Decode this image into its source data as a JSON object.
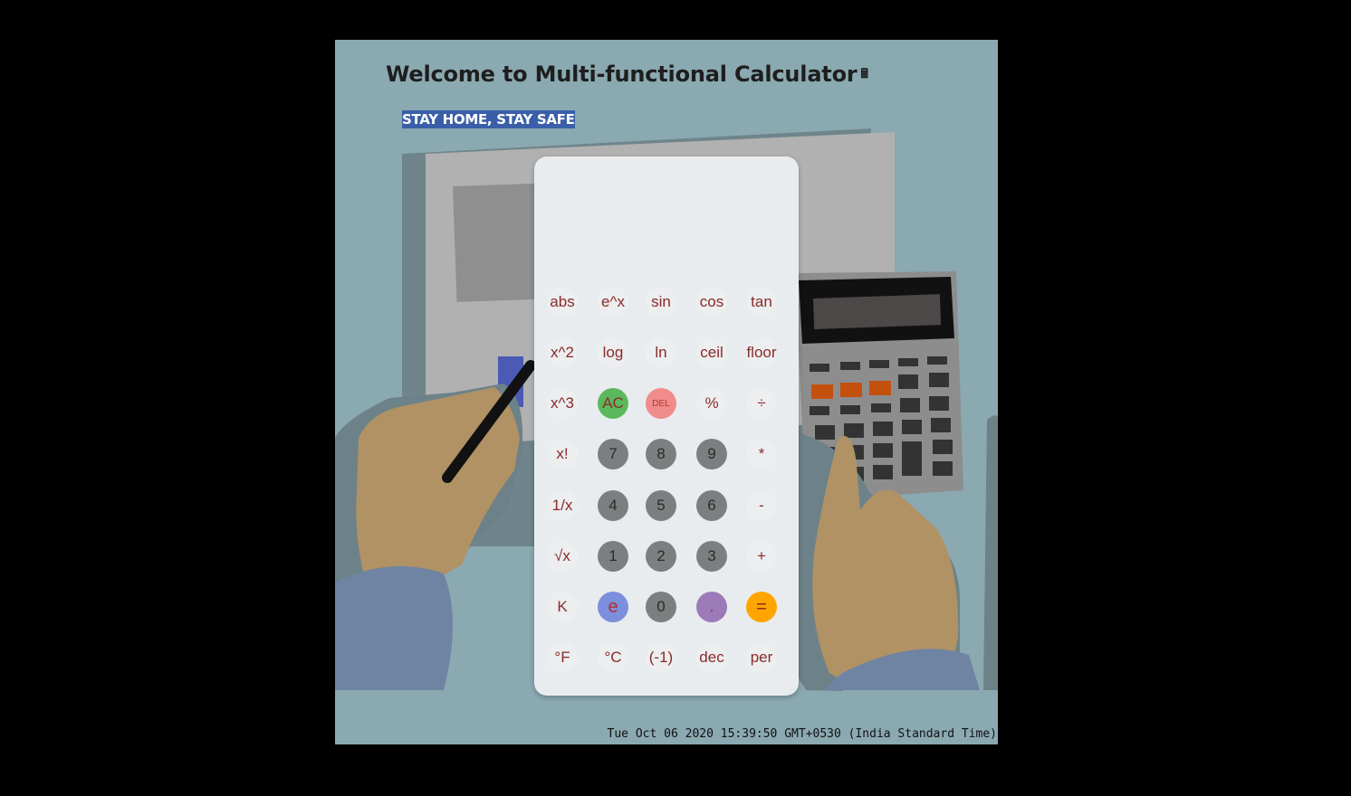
{
  "page": {
    "title": "Welcome to Multi-functional Calculator",
    "title_icon": "calculator-icon",
    "motto": "STAY HOME, STAY SAFE",
    "datetime": "Tue Oct 06 2020 15:39:50 GMT+0530 (India Standard Time)"
  },
  "calculator": {
    "display": "",
    "rows": [
      [
        "abs",
        "e^x",
        "sin",
        "cos",
        "tan"
      ],
      [
        "x^2",
        "log",
        "ln",
        "ceil",
        "floor"
      ],
      [
        "x^3",
        "AC",
        "DEL",
        "%",
        "÷"
      ],
      [
        "x!",
        "7",
        "8",
        "9",
        "*"
      ],
      [
        "1/x",
        "4",
        "5",
        "6",
        "-"
      ],
      [
        "√x",
        "1",
        "2",
        "3",
        "+"
      ],
      [
        "K",
        "e",
        "0",
        ".",
        "="
      ],
      [
        "°F",
        "°C",
        "(-1)",
        "dec",
        "per"
      ]
    ]
  },
  "colors": {
    "background": "#8aa9b1",
    "motto_bg": "#3a5fa8",
    "ac": "#5cb85c",
    "del": "#f08c8c",
    "equals": "#ffa500",
    "digits": "#7c7f80"
  }
}
